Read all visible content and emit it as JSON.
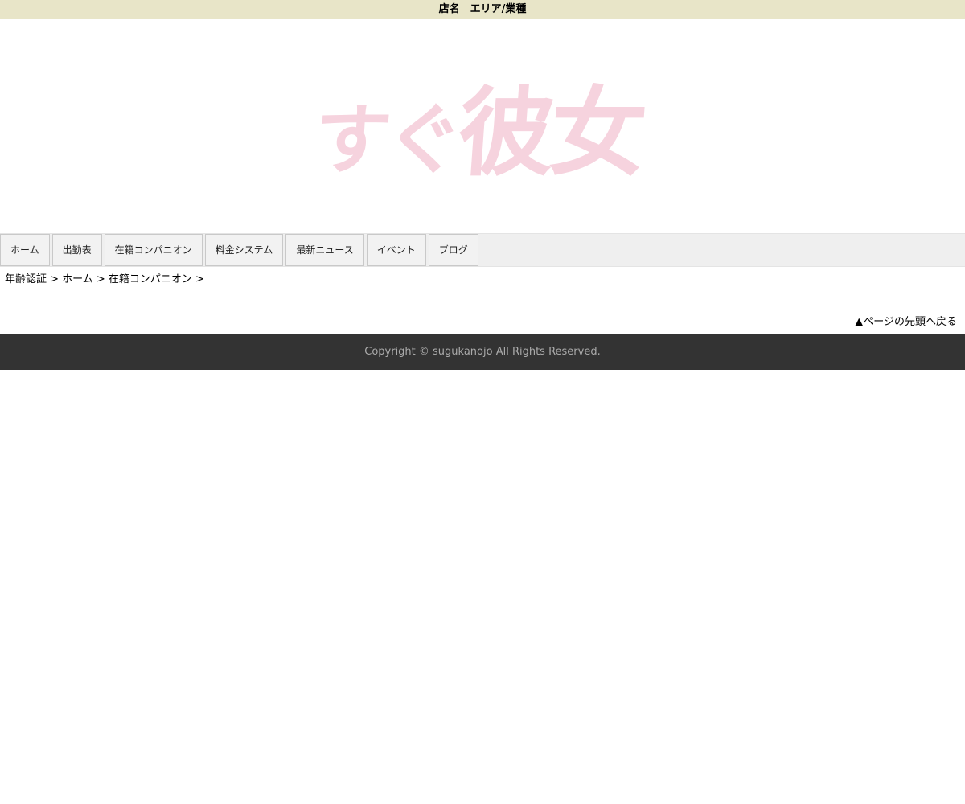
{
  "topbar": {
    "text": "店名　エリア/業種"
  },
  "logo": {
    "part1": "すぐ",
    "part2": "彼女",
    "color": "#f6d3de"
  },
  "nav": {
    "items": [
      {
        "label": "ホーム"
      },
      {
        "label": "出勤表"
      },
      {
        "label": "在籍コンパニオン"
      },
      {
        "label": "料金システム"
      },
      {
        "label": "最新ニュース"
      },
      {
        "label": "イベント"
      },
      {
        "label": "ブログ"
      }
    ]
  },
  "breadcrumb": {
    "text": "年齢認証 > ホーム > 在籍コンパニオン >"
  },
  "pagetop": {
    "label": "▲ページの先頭へ戻る"
  },
  "footer": {
    "copyright": "Copyright © sugukanojo All Rights Reserved."
  }
}
